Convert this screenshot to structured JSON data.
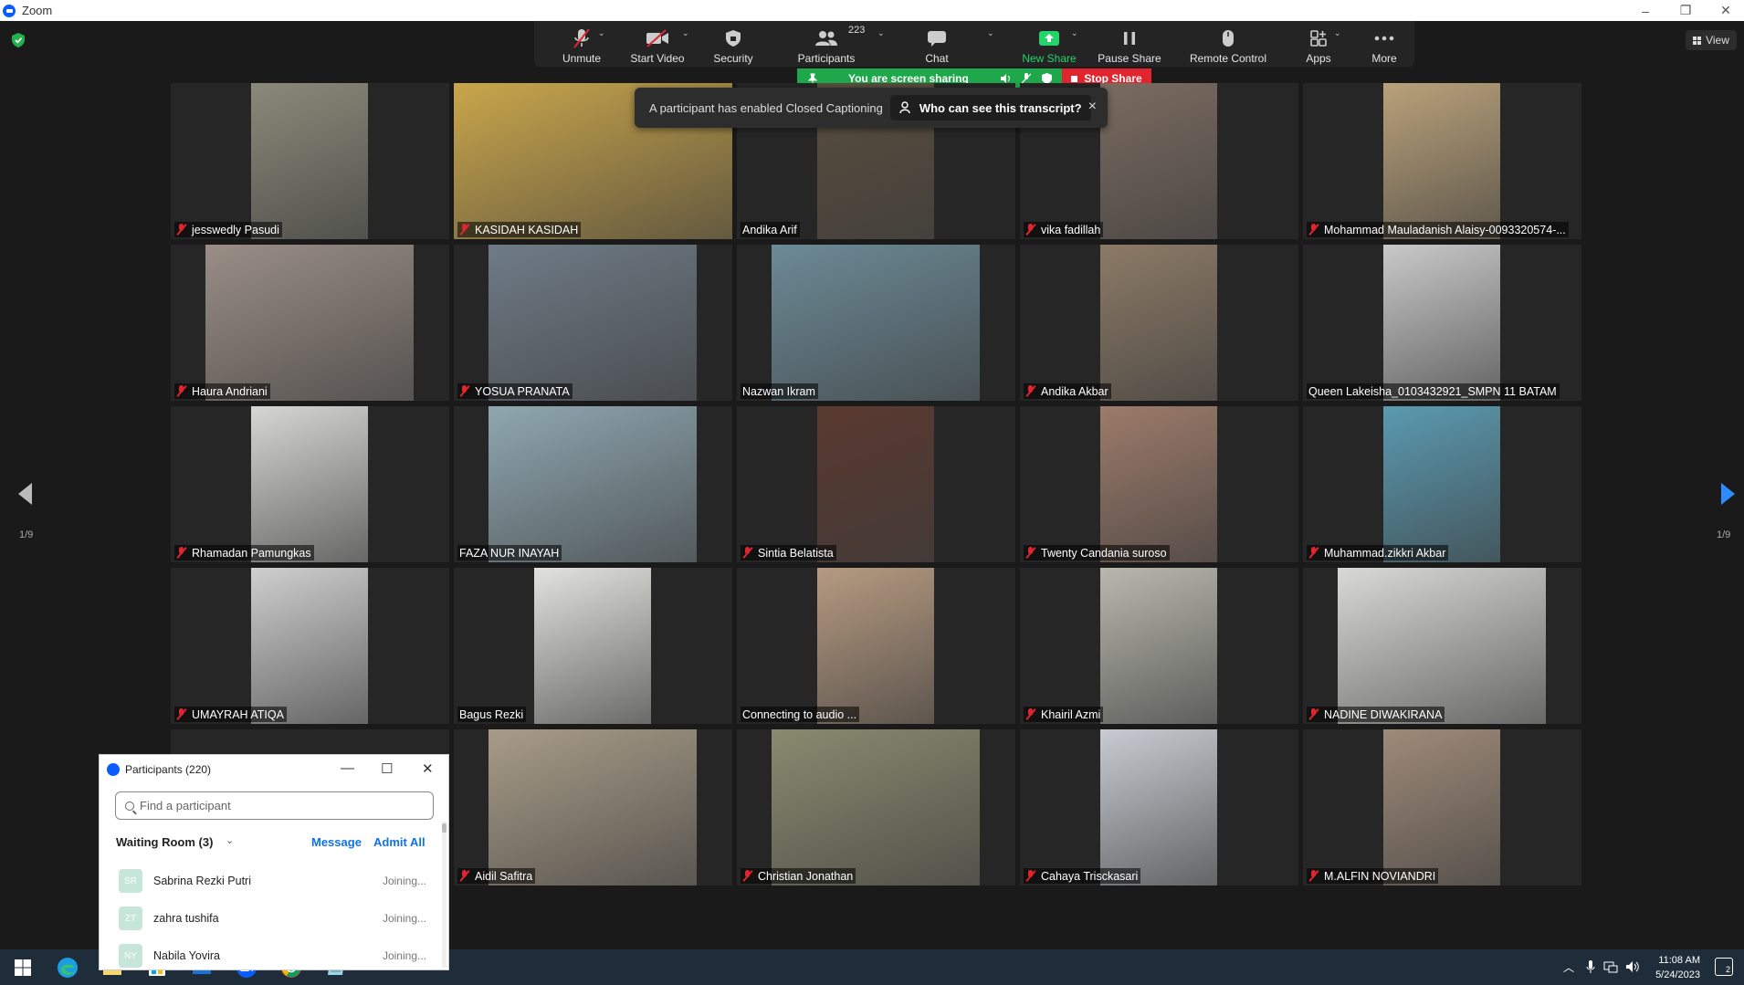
{
  "window": {
    "title": "Zoom"
  },
  "toolbar": {
    "buttons": [
      {
        "id": "unmute",
        "label": "Unmute",
        "icon": "mic-off-icon",
        "caret": true
      },
      {
        "id": "start-video",
        "label": "Start Video",
        "icon": "video-off-icon",
        "caret": true
      },
      {
        "id": "security",
        "label": "Security",
        "icon": "shield-icon",
        "caret": false
      },
      {
        "id": "participants",
        "label": "Participants",
        "icon": "people-icon",
        "caret": true,
        "count": "223"
      },
      {
        "id": "chat",
        "label": "Chat",
        "icon": "chat-icon",
        "caret": true
      },
      {
        "id": "new-share",
        "label": "New Share",
        "icon": "share-up-icon",
        "caret": true,
        "accent": "#24d46b"
      },
      {
        "id": "pause-share",
        "label": "Pause Share",
        "icon": "pause-icon",
        "caret": false
      },
      {
        "id": "remote-control",
        "label": "Remote Control",
        "icon": "mouse-icon",
        "caret": false
      },
      {
        "id": "apps",
        "label": "Apps",
        "icon": "apps-icon",
        "caret": true
      },
      {
        "id": "more",
        "label": "More",
        "icon": "more-dots-icon",
        "caret": false
      }
    ]
  },
  "share_bar": {
    "status": "You are screen sharing",
    "stop_label": "Stop Share",
    "color": "#1fa84b",
    "stop_color": "#e0252f"
  },
  "view_button": {
    "label": "View"
  },
  "toast": {
    "message": "A participant has enabled Closed Captioning",
    "action": "Who can see this transcript?",
    "close": "×"
  },
  "pagination": {
    "left": "1/9",
    "right": "1/9"
  },
  "tiles": [
    {
      "name": "jesswedly Pasudi",
      "muted": true
    },
    {
      "name": "KASIDAH KASIDAH",
      "muted": true
    },
    {
      "name": "Andika Arif",
      "muted": false
    },
    {
      "name": "vika fadillah",
      "muted": true
    },
    {
      "name": "Mohammad Mauladanish Alaisy-0093320574-...",
      "muted": true
    },
    {
      "name": "Haura Andriani",
      "muted": true
    },
    {
      "name": "YOSUA PRANATA",
      "muted": true
    },
    {
      "name": "Nazwan Ikram",
      "muted": false
    },
    {
      "name": "Andika Akbar",
      "muted": true
    },
    {
      "name": "Queen Lakeisha_0103432921_SMPN 11 BATAM",
      "muted": false
    },
    {
      "name": "Rhamadan Pamungkas",
      "muted": true
    },
    {
      "name": "FAZA NUR INAYAH",
      "muted": false
    },
    {
      "name": "Sintia Belatista",
      "muted": true
    },
    {
      "name": "Twenty Candania suroso",
      "muted": true
    },
    {
      "name": "Muhammad.zikkri Akbar",
      "muted": true
    },
    {
      "name": "UMAYRAH ATIQA",
      "muted": true
    },
    {
      "name": "Bagus Rezki",
      "muted": false
    },
    {
      "name": "Connecting to audio ...",
      "muted": false
    },
    {
      "name": "Khairil Azmi",
      "muted": true
    },
    {
      "name": "NADINE DIWAKIRANA",
      "muted": true
    },
    {
      "name": "",
      "muted": false
    },
    {
      "name": "Aidil Safitra",
      "muted": true
    },
    {
      "name": "Christian Jonathan",
      "muted": true
    },
    {
      "name": "Cahaya Trisckasari",
      "muted": true
    },
    {
      "name": "M.ALFIN NOVIANDRI",
      "muted": true
    }
  ],
  "participants_panel": {
    "title": "Participants (220)",
    "search_placeholder": "Find a participant",
    "waiting_room_label": "Waiting Room (3)",
    "message_label": "Message",
    "admit_all_label": "Admit All",
    "waiting": [
      {
        "initials": "SR",
        "name": "Sabrina Rezki Putri",
        "status": "Joining..."
      },
      {
        "initials": "ZT",
        "name": "zahra tushifa",
        "status": "Joining..."
      },
      {
        "initials": "NY",
        "name": "Nabila Yovira",
        "status": "Joining..."
      }
    ]
  },
  "taskbar": {
    "time": "11:08 AM",
    "date": "5/24/2023",
    "notifications": "2",
    "apps": [
      "windows-start-icon",
      "edge-icon",
      "file-explorer-icon",
      "store-icon",
      "mail-icon",
      "zoom-icon",
      "chrome-icon",
      "notes-icon"
    ]
  }
}
